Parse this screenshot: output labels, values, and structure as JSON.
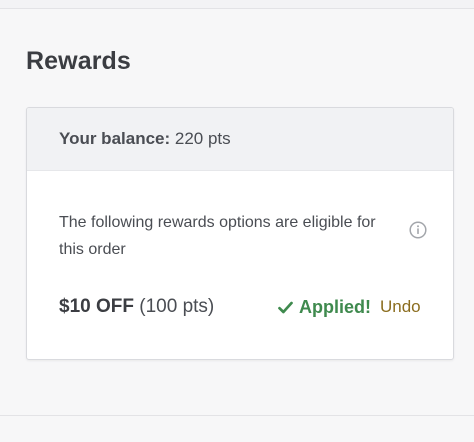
{
  "rewards": {
    "title": "Rewards",
    "balance_label": "Your balance:",
    "balance_value": "220 pts",
    "eligible_text": "The following rewards options are eligible for this order",
    "reward_amount": "$10 OFF",
    "reward_pts": "(100 pts)",
    "applied_label": "Applied!",
    "undo_label": "Undo"
  },
  "icons": {
    "info": "info-icon",
    "check": "check-icon"
  },
  "colors": {
    "applied": "#3f8a4e",
    "undo": "#8b6d1f"
  }
}
